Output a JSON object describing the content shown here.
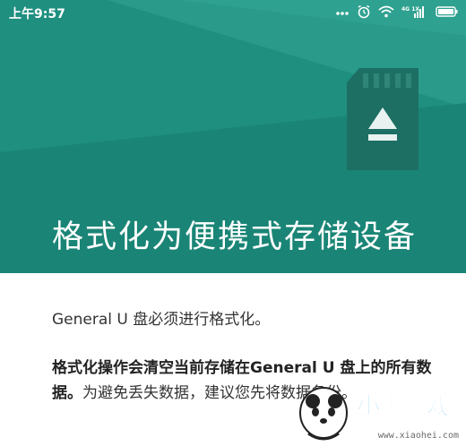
{
  "status_bar": {
    "time": "上午9:57",
    "icons": [
      "more-dots-icon",
      "alarm-icon",
      "wifi-icon",
      "signal-icon",
      "battery-icon"
    ],
    "network_label": "4G 1X"
  },
  "header": {
    "title": "格式化为便携式存储设备",
    "colors": {
      "background": "#1f8f80",
      "card": "#1d6f63",
      "accent": "#ffffff"
    }
  },
  "body": {
    "line1": "General U 盘必须进行格式化。",
    "line2_bold": "格式化操作会清空当前存储在General U 盘上的所有数据。",
    "line2_rest": "为避免丢失数据，建议您先将数据备份。"
  },
  "watermark": {
    "brand": "小黑游戏",
    "url": "www.xiaohei.com"
  }
}
